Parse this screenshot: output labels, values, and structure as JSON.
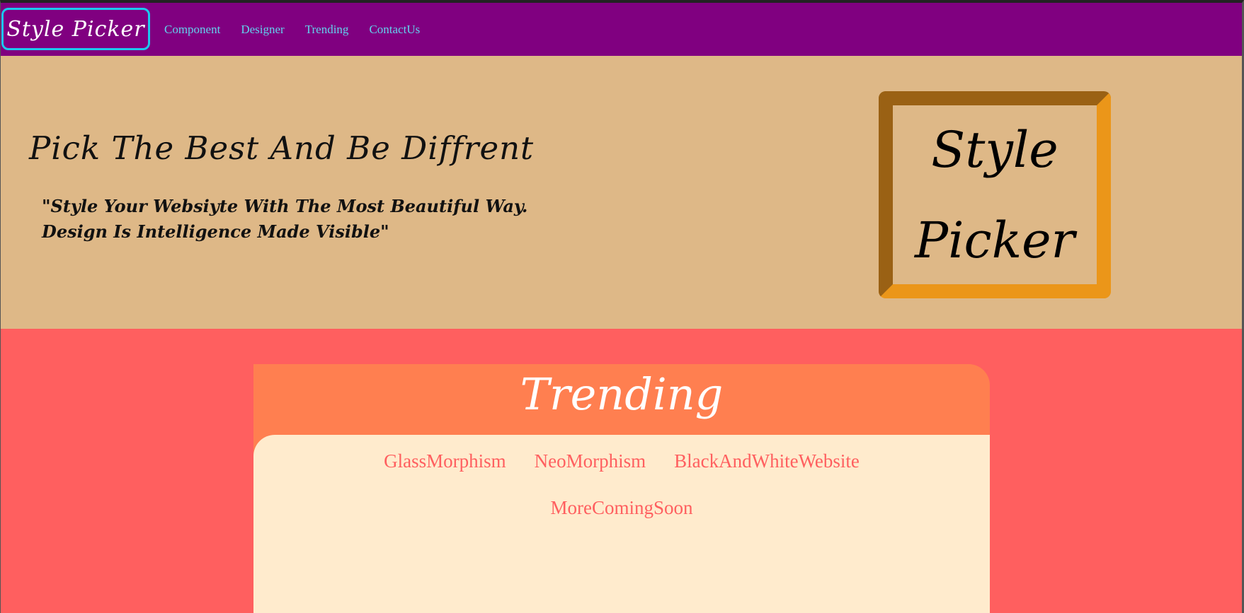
{
  "navbar": {
    "brand": "Style Picker",
    "links": [
      {
        "label": "Component"
      },
      {
        "label": "Designer"
      },
      {
        "label": "Trending"
      },
      {
        "label": "ContactUs"
      }
    ]
  },
  "hero": {
    "title": "Pick The Best And Be Diffrent",
    "quote": "\"Style Your Websiyte With The Most Beautiful Way. Design Is Intelligence Made Visible\"",
    "logo_line1": "Style",
    "logo_line2": "Picker"
  },
  "trending": {
    "title": "Trending",
    "items": [
      {
        "label": "GlassMorphism"
      },
      {
        "label": "NeoMorphism"
      },
      {
        "label": "BlackAndWhiteWebsite"
      },
      {
        "label": "MoreComingSoon"
      }
    ]
  },
  "colors": {
    "navbar_bg": "#800080",
    "brand_border": "#1cc8ee",
    "nav_link": "#62d1ee",
    "hero_bg": "#deb887",
    "logo_border_dark": "#9a6114",
    "logo_border_light": "#eb9619",
    "section_bg": "#ff5f5f",
    "trending_header_bg": "#ff7f50",
    "trending_panel_bg": "#ffebcd"
  }
}
